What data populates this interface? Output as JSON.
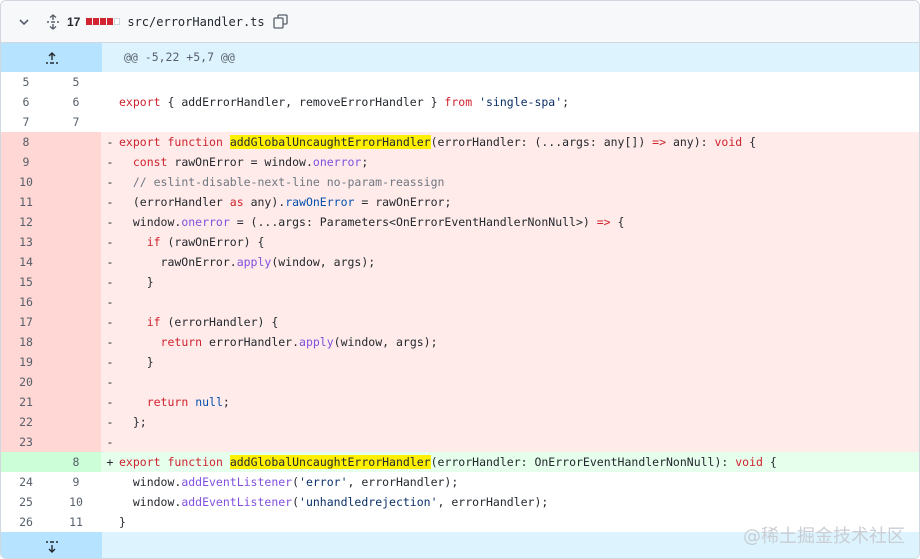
{
  "file": {
    "additions_count": "17",
    "path": "src/errorHandler.ts",
    "diffstat_colors": [
      "#d1242f",
      "#d1242f",
      "#d1242f",
      "#d1242f",
      "#ffffff"
    ]
  },
  "hunks": {
    "top": "@@ -5,22 +5,7 @@"
  },
  "rows": [
    {
      "old": "5",
      "new": "5",
      "type": "ctx",
      "marker": " ",
      "segs": [
        [
          "",
          ""
        ]
      ]
    },
    {
      "old": "6",
      "new": "6",
      "type": "ctx",
      "marker": " ",
      "segs": [
        [
          "kw",
          "export"
        ],
        [
          "",
          " { addErrorHandler, removeErrorHandler } "
        ],
        [
          "kw",
          "from"
        ],
        [
          "",
          " "
        ],
        [
          "st",
          "'single-spa'"
        ],
        [
          "",
          ";"
        ]
      ]
    },
    {
      "old": "7",
      "new": "7",
      "type": "ctx",
      "marker": " ",
      "segs": [
        [
          "",
          ""
        ]
      ]
    },
    {
      "old": "8",
      "new": "",
      "type": "del",
      "marker": "-",
      "segs": [
        [
          "kw",
          "export"
        ],
        [
          "",
          " "
        ],
        [
          "kw",
          "function"
        ],
        [
          "",
          " "
        ],
        [
          "hl",
          "addGlobalUncaughtErrorHandler"
        ],
        [
          "",
          "(errorHandler: (...args: any[]) "
        ],
        [
          "kw",
          "=>"
        ],
        [
          "",
          " any): "
        ],
        [
          "kw",
          "void"
        ],
        [
          "",
          " {"
        ]
      ]
    },
    {
      "old": "9",
      "new": "",
      "type": "del",
      "marker": "-",
      "segs": [
        [
          "",
          "  "
        ],
        [
          "kw",
          "const"
        ],
        [
          "",
          " rawOnError = window."
        ],
        [
          "kp",
          "onerror"
        ],
        [
          "",
          ";"
        ]
      ]
    },
    {
      "old": "10",
      "new": "",
      "type": "del",
      "marker": "-",
      "segs": [
        [
          "",
          "  "
        ],
        [
          "cm",
          "// eslint-disable-next-line no-param-reassign"
        ]
      ]
    },
    {
      "old": "11",
      "new": "",
      "type": "del",
      "marker": "-",
      "segs": [
        [
          "",
          "  (errorHandler "
        ],
        [
          "kw",
          "as"
        ],
        [
          "",
          " any)."
        ],
        [
          "ct",
          "rawOnError"
        ],
        [
          "",
          " = rawOnError;"
        ]
      ]
    },
    {
      "old": "12",
      "new": "",
      "type": "del",
      "marker": "-",
      "segs": [
        [
          "",
          "  window."
        ],
        [
          "kp",
          "onerror"
        ],
        [
          "",
          " = (...args: Parameters<OnErrorEventHandlerNonNull>) "
        ],
        [
          "kw",
          "=>"
        ],
        [
          "",
          " {"
        ]
      ]
    },
    {
      "old": "13",
      "new": "",
      "type": "del",
      "marker": "-",
      "segs": [
        [
          "",
          "    "
        ],
        [
          "kw",
          "if"
        ],
        [
          "",
          " (rawOnError) {"
        ]
      ]
    },
    {
      "old": "14",
      "new": "",
      "type": "del",
      "marker": "-",
      "segs": [
        [
          "",
          "      rawOnError."
        ],
        [
          "kp",
          "apply"
        ],
        [
          "",
          "(window, args);"
        ]
      ]
    },
    {
      "old": "15",
      "new": "",
      "type": "del",
      "marker": "-",
      "segs": [
        [
          "",
          "    }"
        ]
      ]
    },
    {
      "old": "16",
      "new": "",
      "type": "del",
      "marker": "-",
      "segs": [
        [
          "",
          ""
        ]
      ]
    },
    {
      "old": "17",
      "new": "",
      "type": "del",
      "marker": "-",
      "segs": [
        [
          "",
          "    "
        ],
        [
          "kw",
          "if"
        ],
        [
          "",
          " (errorHandler) {"
        ]
      ]
    },
    {
      "old": "18",
      "new": "",
      "type": "del",
      "marker": "-",
      "segs": [
        [
          "",
          "      "
        ],
        [
          "kw",
          "return"
        ],
        [
          "",
          " errorHandler."
        ],
        [
          "kp",
          "apply"
        ],
        [
          "",
          "(window, args);"
        ]
      ]
    },
    {
      "old": "19",
      "new": "",
      "type": "del",
      "marker": "-",
      "segs": [
        [
          "",
          "    }"
        ]
      ]
    },
    {
      "old": "20",
      "new": "",
      "type": "del",
      "marker": "-",
      "segs": [
        [
          "",
          ""
        ]
      ]
    },
    {
      "old": "21",
      "new": "",
      "type": "del",
      "marker": "-",
      "segs": [
        [
          "",
          "    "
        ],
        [
          "kw",
          "return"
        ],
        [
          "",
          " "
        ],
        [
          "ct",
          "null"
        ],
        [
          "",
          ";"
        ]
      ]
    },
    {
      "old": "22",
      "new": "",
      "type": "del",
      "marker": "-",
      "segs": [
        [
          "",
          "  };"
        ]
      ]
    },
    {
      "old": "23",
      "new": "",
      "type": "del",
      "marker": "-",
      "segs": [
        [
          "",
          ""
        ]
      ]
    },
    {
      "old": "",
      "new": "8",
      "type": "add",
      "marker": "+",
      "segs": [
        [
          "kw",
          "export"
        ],
        [
          "",
          " "
        ],
        [
          "kw",
          "function"
        ],
        [
          "",
          " "
        ],
        [
          "hl",
          "addGlobalUncaughtErrorHandler"
        ],
        [
          "",
          "(errorHandler: OnErrorEventHandlerNonNull): "
        ],
        [
          "kw",
          "void"
        ],
        [
          "",
          " {"
        ]
      ]
    },
    {
      "old": "24",
      "new": "9",
      "type": "ctx",
      "marker": " ",
      "segs": [
        [
          "",
          "  window."
        ],
        [
          "kp",
          "addEventListener"
        ],
        [
          "",
          "("
        ],
        [
          "st",
          "'error'"
        ],
        [
          "",
          ", errorHandler);"
        ]
      ]
    },
    {
      "old": "25",
      "new": "10",
      "type": "ctx",
      "marker": " ",
      "segs": [
        [
          "",
          "  window."
        ],
        [
          "kp",
          "addEventListener"
        ],
        [
          "",
          "("
        ],
        [
          "st",
          "'unhandledrejection'"
        ],
        [
          "",
          ", errorHandler);"
        ]
      ]
    },
    {
      "old": "26",
      "new": "11",
      "type": "ctx",
      "marker": " ",
      "segs": [
        [
          "",
          "}"
        ]
      ]
    }
  ],
  "watermark": "@稀土掘金技术社区",
  "colors": {
    "deletion_num_bg": "#ffd7d5",
    "deletion_code_bg": "#ffebe9",
    "addition_num_bg": "#ccffd8",
    "addition_code_bg": "#e6ffec",
    "hunk_bg": "#ddf4ff",
    "hunk_button_bg": "#b6e3ff",
    "highlight": "#fff000"
  },
  "icons": {
    "collapse": "chevron-down-icon",
    "expand_all": "unfold-icon",
    "copy": "copy-icon",
    "expand_up": "expand-up-icon",
    "expand_down": "expand-down-icon"
  }
}
